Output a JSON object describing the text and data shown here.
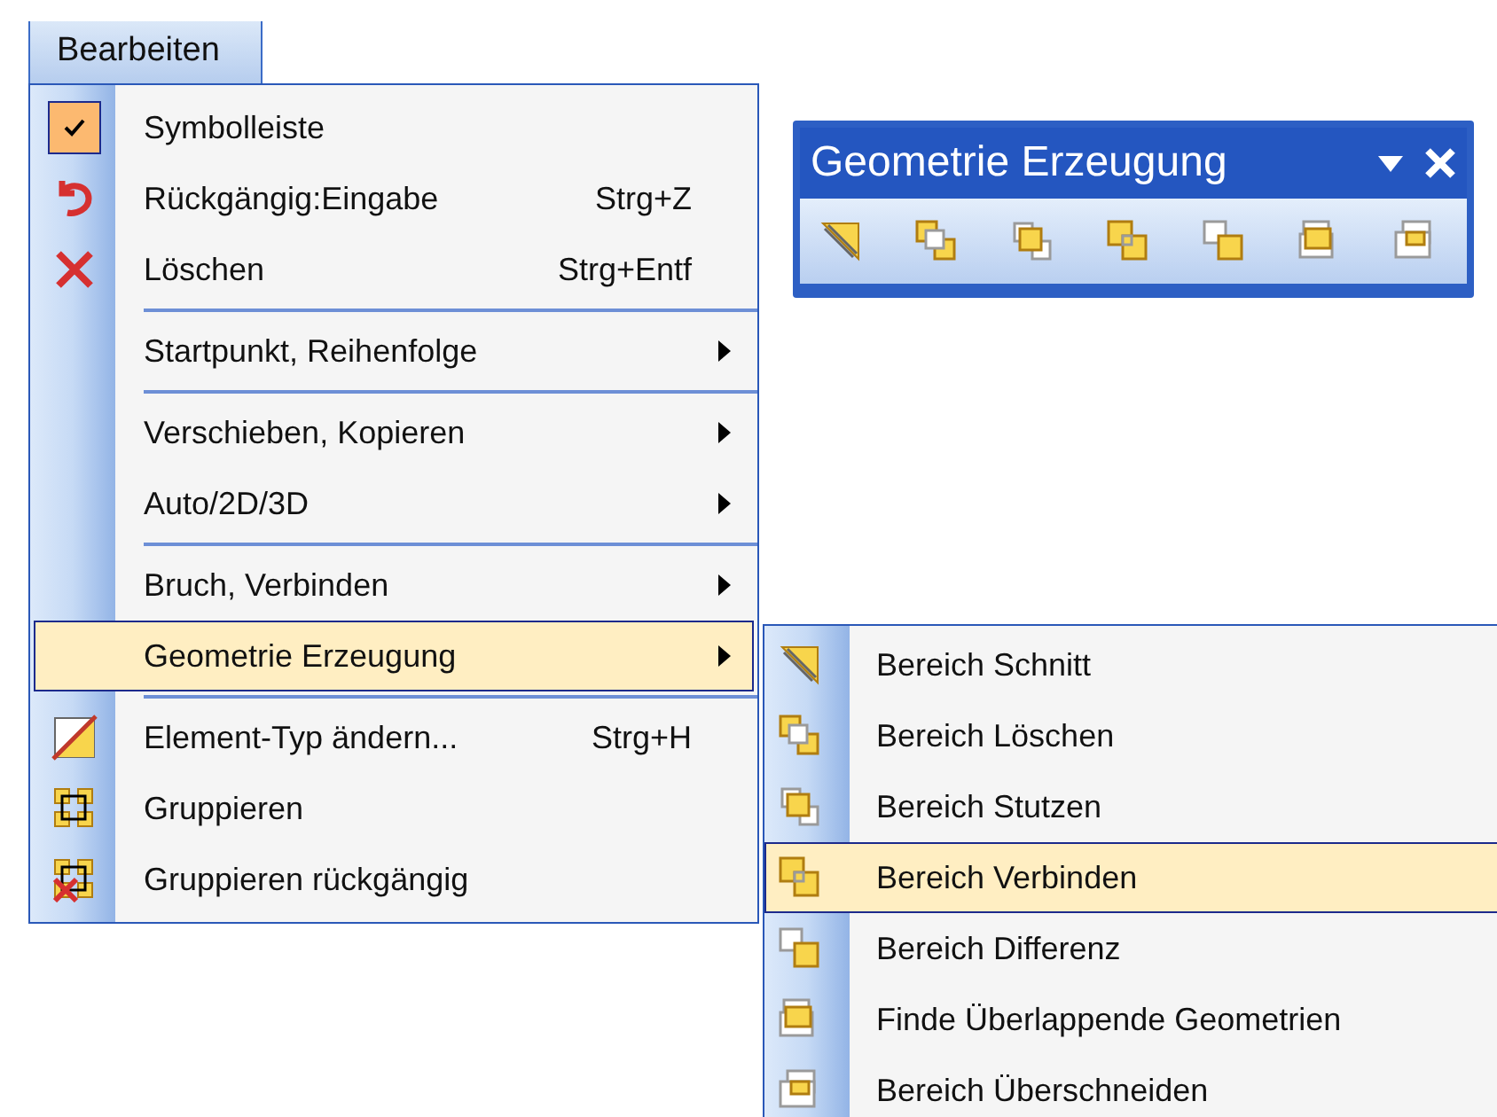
{
  "menu_bar": {
    "label": "Bearbeiten",
    "selected": true
  },
  "menu": {
    "items": [
      {
        "kind": "item",
        "label": "Symbolleiste",
        "checked": true,
        "selected": false
      },
      {
        "kind": "item",
        "label": "Rückgängig:Eingabe",
        "shortcut": "Strg+Z",
        "selected": false
      },
      {
        "kind": "item",
        "label": "Löschen",
        "shortcut": "Strg+Entf",
        "selected": false
      },
      {
        "kind": "separator"
      },
      {
        "kind": "submenu",
        "label": "Startpunkt, Reihenfolge",
        "selected": false
      },
      {
        "kind": "separator"
      },
      {
        "kind": "submenu",
        "label": "Verschieben, Kopieren",
        "selected": false
      },
      {
        "kind": "submenu",
        "label": "Auto/2D/3D",
        "selected": false
      },
      {
        "kind": "separator"
      },
      {
        "kind": "submenu",
        "label": "Bruch, Verbinden",
        "selected": false
      },
      {
        "kind": "submenu",
        "label": "Geometrie Erzeugung",
        "selected": true
      },
      {
        "kind": "separator"
      },
      {
        "kind": "item",
        "label": "Element-Typ ändern...",
        "shortcut": "Strg+H",
        "selected": false
      },
      {
        "kind": "item",
        "label": "Gruppieren",
        "selected": false
      },
      {
        "kind": "item",
        "label": "Gruppieren rückgängig",
        "selected": false
      }
    ]
  },
  "submenu": {
    "items": [
      {
        "label": "Bereich Schnitt",
        "selected": false
      },
      {
        "label": "Bereich Löschen",
        "selected": false
      },
      {
        "label": "Bereich Stutzen",
        "selected": false
      },
      {
        "label": "Bereich Verbinden",
        "selected": true
      },
      {
        "label": "Bereich Differenz",
        "selected": false
      },
      {
        "label": "Finde Überlappende Geometrien",
        "selected": false
      },
      {
        "label": "Bereich Überschneiden",
        "selected": false
      }
    ]
  },
  "toolbar": {
    "title": "Geometrie Erzeugung"
  }
}
